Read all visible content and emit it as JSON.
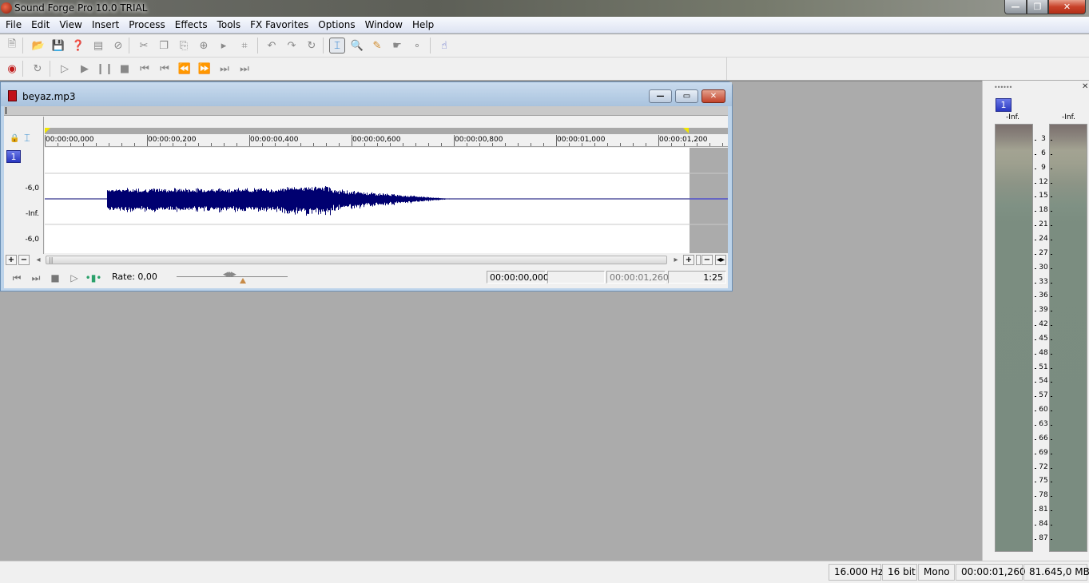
{
  "app": {
    "title": "Sound Forge Pro 10.0 TRIAL"
  },
  "window_controls": {
    "minimize": "—",
    "restore": "❐",
    "close": "✕"
  },
  "menu": [
    "File",
    "Edit",
    "View",
    "Insert",
    "Process",
    "Effects",
    "Tools",
    "FX Favorites",
    "Options",
    "Window",
    "Help"
  ],
  "toolbar_main": [
    {
      "name": "new-icon",
      "glyph": "🗎"
    },
    {
      "name": "open-icon",
      "glyph": "📂"
    },
    {
      "name": "save-icon",
      "glyph": "💾"
    },
    {
      "name": "save-as-icon",
      "glyph": "❓"
    },
    {
      "name": "render-icon",
      "glyph": "▤"
    },
    {
      "name": "burn-cd-icon",
      "glyph": "⊘"
    },
    {
      "name": "cut-icon",
      "glyph": "✂"
    },
    {
      "name": "copy-icon",
      "glyph": "❐"
    },
    {
      "name": "paste-icon",
      "glyph": "⎘"
    },
    {
      "name": "mix-icon",
      "glyph": "⊕"
    },
    {
      "name": "paste-special-icon",
      "glyph": "▸"
    },
    {
      "name": "trim-crop-icon",
      "glyph": "⌗"
    },
    {
      "name": "undo-icon",
      "glyph": "↶"
    },
    {
      "name": "redo-icon",
      "glyph": "↷"
    },
    {
      "name": "repeat-icon",
      "glyph": "↻"
    },
    {
      "name": "edit-tool-icon",
      "glyph": "⌶",
      "active": true
    },
    {
      "name": "magnify-tool-icon",
      "glyph": "🔍"
    },
    {
      "name": "pencil-tool-icon",
      "glyph": "✎"
    },
    {
      "name": "event-tool-icon",
      "glyph": "☛"
    },
    {
      "name": "envelope-tool-icon",
      "glyph": "∘"
    },
    {
      "name": "hand-icon",
      "glyph": "☝"
    }
  ],
  "toolbar_transport": [
    {
      "name": "record-icon",
      "glyph": "◉"
    },
    {
      "name": "loop-icon",
      "glyph": "↻"
    },
    {
      "name": "play-all-icon",
      "glyph": "▷"
    },
    {
      "name": "play-icon",
      "glyph": "▶"
    },
    {
      "name": "pause-icon",
      "glyph": "❙❙"
    },
    {
      "name": "stop-icon",
      "glyph": "■"
    },
    {
      "name": "go-to-start-icon",
      "glyph": "⏮"
    },
    {
      "name": "previous-marker-icon",
      "glyph": "⏮"
    },
    {
      "name": "rewind-icon",
      "glyph": "⏪"
    },
    {
      "name": "fast-forward-icon",
      "glyph": "⏩"
    },
    {
      "name": "next-marker-icon",
      "glyph": "⏭"
    },
    {
      "name": "go-to-end-icon",
      "glyph": "⏭"
    }
  ],
  "document": {
    "filename": "beyaz.mp3",
    "channel": "1",
    "y_labels": [
      "-6,0",
      "-Inf.",
      "-6,0"
    ],
    "ruler_labels": [
      "00:00:00,000",
      "00:00:00,200",
      "00:00:00,400",
      "00:00:00,600",
      "00:00:00,800",
      "00:00:01,000",
      "00:00:01,200"
    ],
    "rate_label": "Rate: 0,00",
    "cursor_position": "00:00:00,000",
    "selection_length": "",
    "file_length": "00:00:01,260",
    "zoom_ratio": "1:25",
    "waveform_color": "#000070",
    "duration_seconds": 1.26
  },
  "level_meter": {
    "channel": "1",
    "peak_left": "-Inf.",
    "peak_right": "-Inf.",
    "scale": [
      "3",
      "6",
      "9",
      "12",
      "15",
      "18",
      "21",
      "24",
      "27",
      "30",
      "33",
      "36",
      "39",
      "42",
      "45",
      "48",
      "51",
      "54",
      "57",
      "60",
      "63",
      "66",
      "69",
      "72",
      "75",
      "78",
      "81",
      "84",
      "87"
    ]
  },
  "status": {
    "sample_rate": "16.000 Hz",
    "bit_depth": "16 bit",
    "channels": "Mono",
    "length": "00:00:01,260",
    "disk_space": "81.645,0 MB"
  }
}
